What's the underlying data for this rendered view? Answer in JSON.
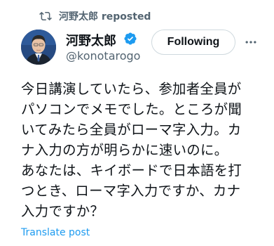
{
  "social_context": {
    "icon": "repost-icon",
    "text": "河野太郎 reposted"
  },
  "author": {
    "name": "河野太郎",
    "handle": "@konotarogo",
    "verified_icon": "verified-badge-icon",
    "avatar_icon": "avatar-photo"
  },
  "actions": {
    "follow_label": "Following",
    "more_icon": "more-icon"
  },
  "tweet": {
    "lines": [
      "今日講演していたら、参加者全員が",
      "パソコンでメモでした。ところが聞",
      "いてみたら全員がローマ字入力。カ",
      "ナ入力の方が明らかに速いのに。",
      "あなたは、キイボードで日本語を打",
      "つとき、ローマ字入力ですか、カナ",
      "入力ですか？"
    ]
  },
  "footer": {
    "translate_label": "Translate post"
  },
  "colors": {
    "primary_text": "#0f1419",
    "secondary_text": "#536471",
    "link": "#1d9bf0",
    "verified": "#1d9bf0",
    "border": "#cfd9de"
  }
}
